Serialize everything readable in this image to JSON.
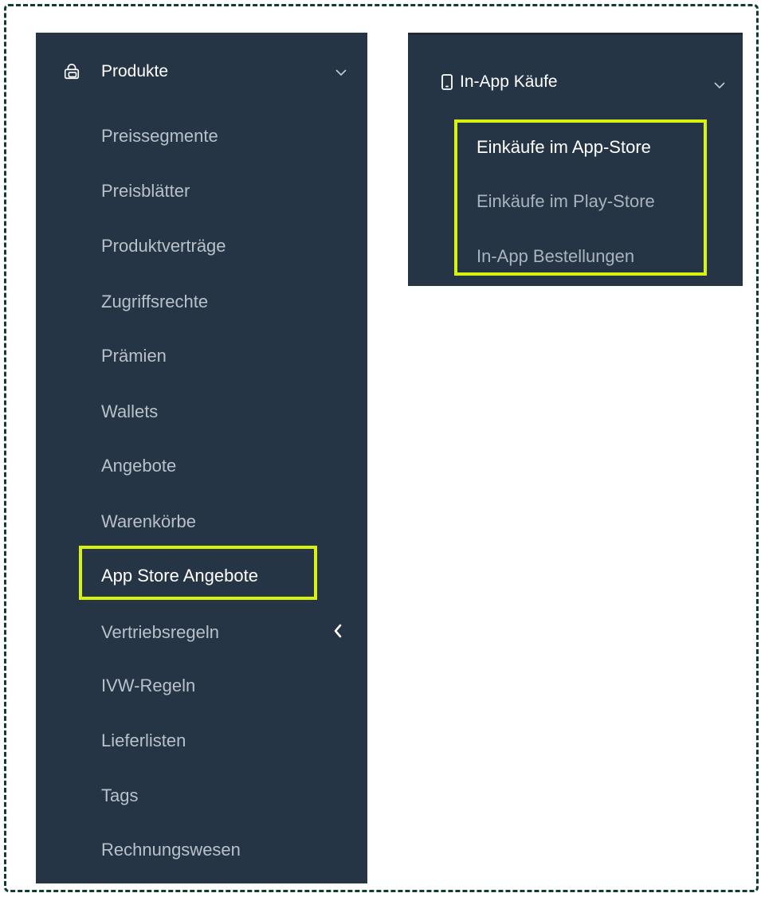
{
  "sidebar": {
    "group": {
      "label": "Produkte",
      "icon": "shopping-bag-icon",
      "expanded": true
    },
    "items": [
      {
        "label": "Preissegmente"
      },
      {
        "label": "Preisblätter"
      },
      {
        "label": "Produktverträge"
      },
      {
        "label": "Zugriffsrechte"
      },
      {
        "label": "Prämien"
      },
      {
        "label": "Wallets"
      },
      {
        "label": "Angebote"
      },
      {
        "label": "Warenkörbe"
      },
      {
        "label": "App Store Angebote",
        "active": true
      },
      {
        "label": "Vertriebsregeln",
        "has_submenu": true
      },
      {
        "label": "IVW-Regeln"
      },
      {
        "label": "Lieferlisten"
      },
      {
        "label": "Tags"
      },
      {
        "label": "Rechnungswesen"
      }
    ]
  },
  "submenu": {
    "group": {
      "label": "In-App Käufe",
      "icon": "smartphone-icon",
      "expanded": true
    },
    "items": [
      {
        "label": "Einkäufe im App-Store",
        "active": true
      },
      {
        "label": "Einkäufe im Play-Store"
      },
      {
        "label": "In-App Bestellungen"
      }
    ]
  },
  "colors": {
    "panel_bg": "#263545",
    "highlight": "#d7f20d",
    "active_text": "#ffffff",
    "inactive_text": "#b8c1ca"
  }
}
